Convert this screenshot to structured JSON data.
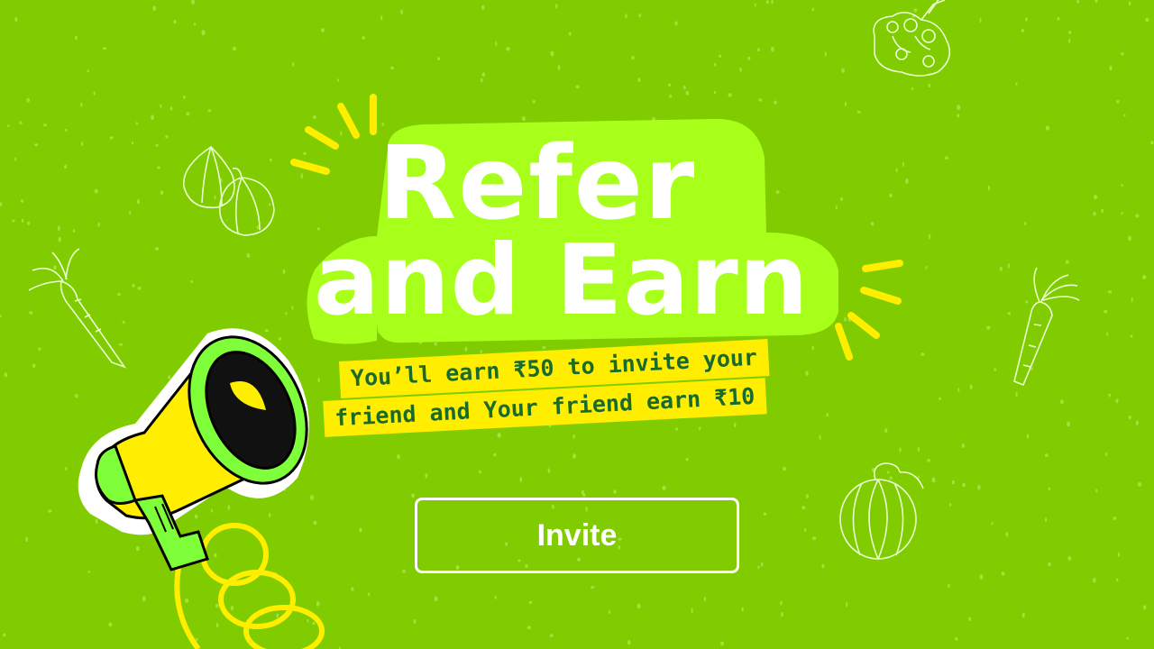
{
  "banner": {
    "title_line1": "Refer",
    "title_line2": "and Earn",
    "subtitle_line1": "You’ll earn ₹50 to invite your",
    "subtitle_line2": "friend and Your friend earn ₹10"
  },
  "invite_button": {
    "label": "Invite"
  },
  "icons": [
    "megaphone-icon",
    "onion-icon",
    "carrot-icon",
    "broccoli-icon",
    "pumpkin-icon"
  ],
  "colors": {
    "background": "#80cc00",
    "blob": "#a8ff1a",
    "highlight": "#ffee00",
    "subtitle_text": "#1a6b2a",
    "text": "#ffffff"
  }
}
